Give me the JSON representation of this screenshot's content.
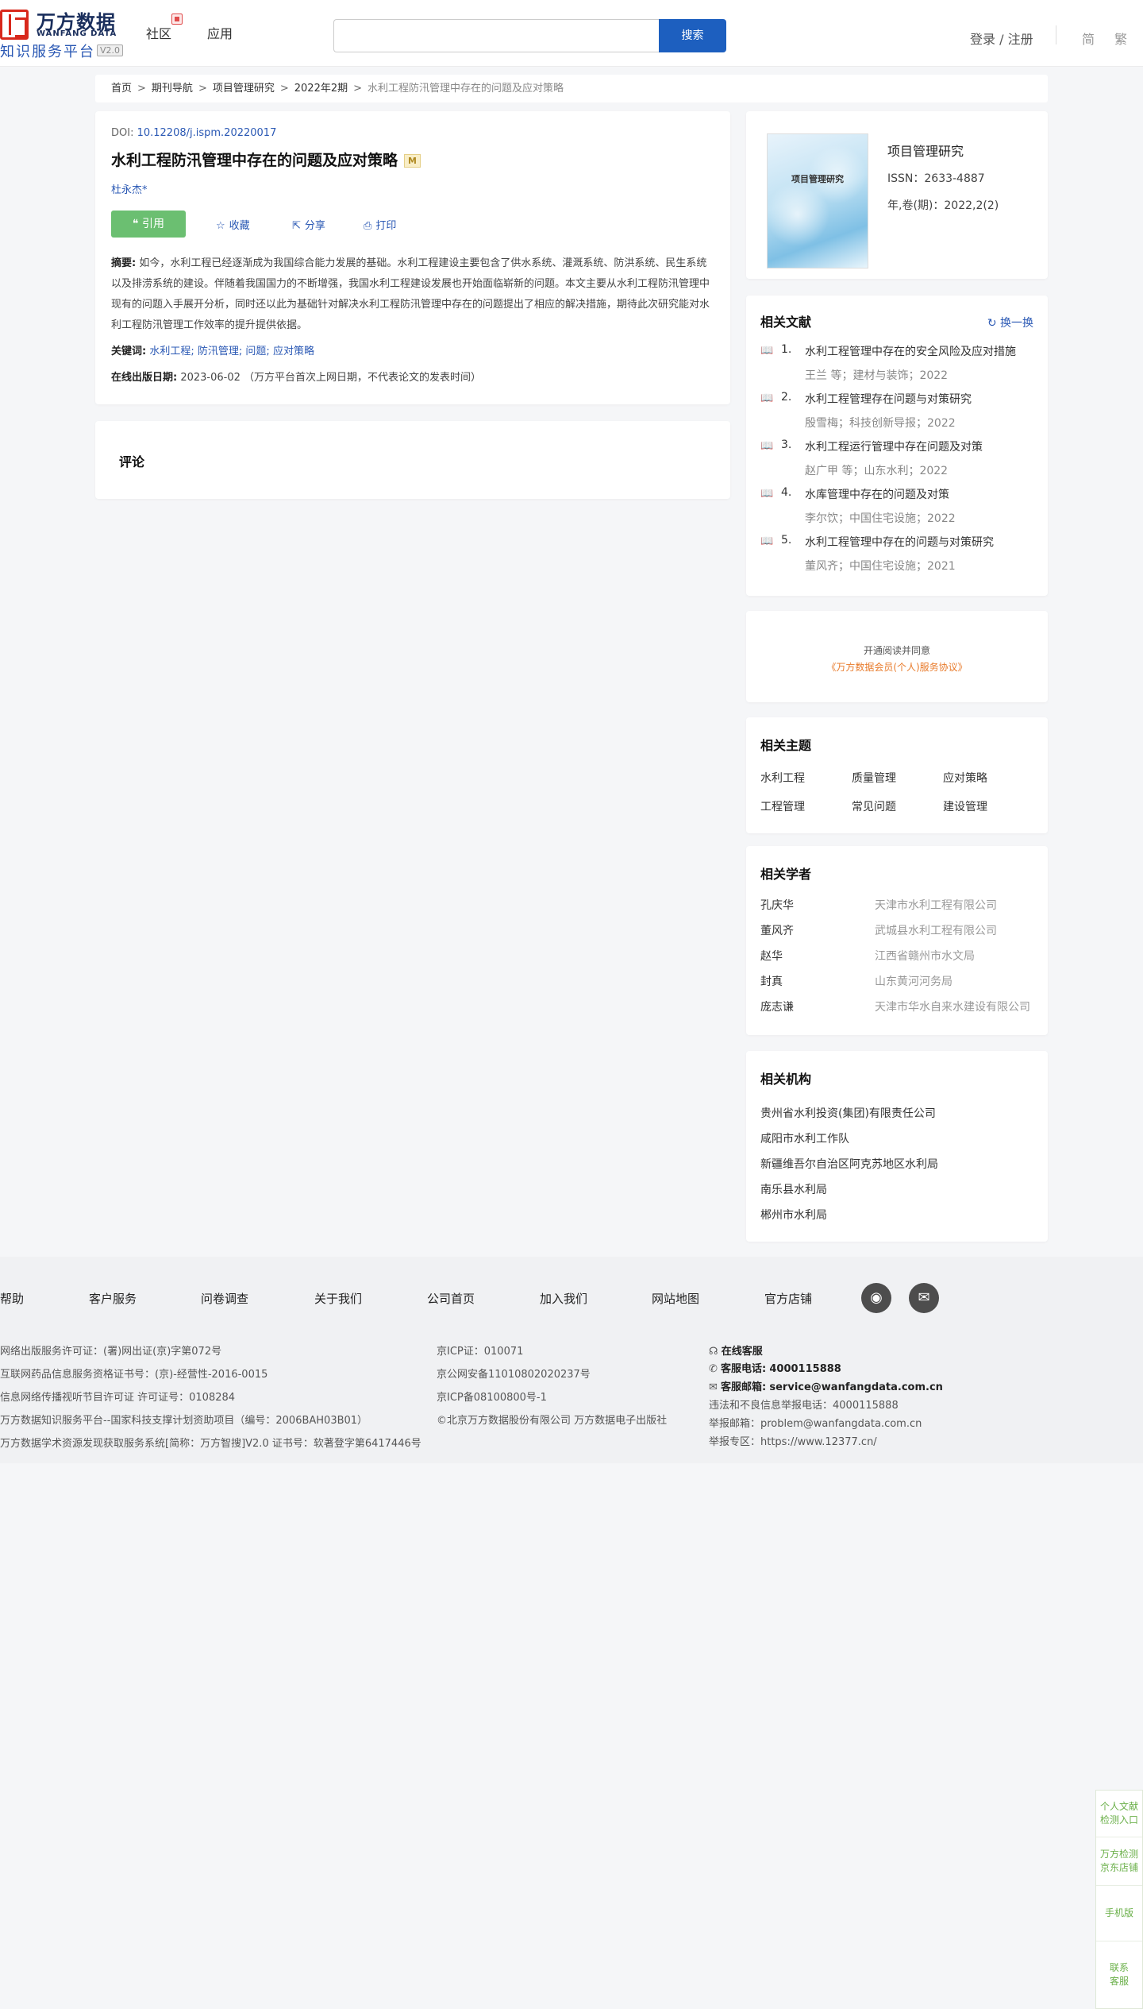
{
  "header": {
    "logo_cn": "万方数据",
    "logo_en": "WANFANG DATA",
    "logo_sub": "知识服务平台",
    "logo_version": "V2.0",
    "nav_community": "社区",
    "nav_app": "应用",
    "search_placeholder": "",
    "search_button": "搜索",
    "login": "登录 / 注册",
    "lang_simplified": "简",
    "lang_traditional": "繁"
  },
  "breadcrumb": {
    "items": [
      "首页",
      "期刊导航",
      "项目管理研究",
      "2022年2期"
    ],
    "current": "水利工程防汛管理中存在的问题及应对策略"
  },
  "article": {
    "doi_label": "DOI: ",
    "doi": "10.12208/j.ispm.20220017",
    "title": "水利工程防汛管理中存在的问题及应对策略",
    "badge": "M",
    "author": "杜永杰*",
    "cite_label": "引用",
    "collect_label": "收藏",
    "share_label": "分享",
    "print_label": "打印",
    "abstract_label": "摘要:",
    "abstract": "如今，水利工程已经逐渐成为我国综合能力发展的基础。水利工程建设主要包含了供水系统、灌溉系统、防洪系统、民生系统以及排涝系统的建设。伴随着我国国力的不断增强，我国水利工程建设发展也开始面临崭新的问题。本文主要从水利工程防汛管理中现有的问题入手展开分析，同时还以此为基础针对解决水利工程防汛管理中存在的问题提出了相应的解决措施，期待此次研究能对水利工程防汛管理工作效率的提升提供依据。",
    "keywords_label": "关键词:",
    "keywords": [
      "水利工程",
      "防汛管理",
      "问题",
      "应对策略"
    ],
    "date_label": "在线出版日期:",
    "date": "2023-06-02",
    "date_note": "（万方平台首次上网日期，不代表论文的发表时间）"
  },
  "comment": {
    "title": "评论"
  },
  "journal": {
    "cover_title": "项目管理研究",
    "name": "项目管理研究",
    "issn": "ISSN：2633-4887",
    "volume": "年,卷(期)：2022,2(2)"
  },
  "related_docs": {
    "title": "相关文献",
    "refresh_label": "换一换",
    "items": [
      {
        "num": "1.",
        "title": "水利工程管理中存在的安全风险及应对措施",
        "meta": "王兰  等；建材与装饰；2022"
      },
      {
        "num": "2.",
        "title": "水利工程管理存在问题与对策研究",
        "meta": "殷雪梅；科技创新导报；2022"
      },
      {
        "num": "3.",
        "title": "水利工程运行管理中存在问题及对策",
        "meta": "赵广甲  等；山东水利；2022"
      },
      {
        "num": "4.",
        "title": "水库管理中存在的问题及对策",
        "meta": "李尔饮；中国住宅设施；2022"
      },
      {
        "num": "5.",
        "title": "水利工程管理中存在的问题与对策研究",
        "meta": "董风齐；中国住宅设施；2021"
      }
    ]
  },
  "agreement": {
    "line1": "开通阅读并同意",
    "line2": "《万方数据会员(个人)服务协议》"
  },
  "topics": {
    "title": "相关主题",
    "items": [
      "水利工程",
      "质量管理",
      "应对策略",
      "工程管理",
      "常见问题",
      "建设管理"
    ]
  },
  "scholars": {
    "title": "相关学者",
    "items": [
      {
        "name": "孔庆华",
        "org": "天津市水利工程有限公司"
      },
      {
        "name": "董风齐",
        "org": "武城县水利工程有限公司"
      },
      {
        "name": "赵华",
        "org": "江西省赣州市水文局"
      },
      {
        "name": "封真",
        "org": "山东黄河河务局"
      },
      {
        "name": "庞志谦",
        "org": "天津市华水自来水建设有限公司"
      }
    ]
  },
  "orgs": {
    "title": "相关机构",
    "items": [
      "贵州省水利投资(集团)有限责任公司",
      "咸阳市水利工作队",
      "新疆维吾尔自治区阿克苏地区水利局",
      "南乐县水利局",
      "郴州市水利局"
    ]
  },
  "footer": {
    "nav": [
      "帮助",
      "客户服务",
      "问卷调查",
      "关于我们",
      "公司首页",
      "加入我们",
      "网站地图",
      "官方店铺"
    ],
    "col1": [
      "网络出版服务许可证：(署)网出证(京)字第072号",
      "互联网药品信息服务资格证书号：(京)-经营性-2016-0015",
      "信息网络传播视听节目许可证 许可证号：0108284",
      "万方数据知识服务平台--国家科技支撑计划资助项目（编号：2006BAH03B01）",
      "万方数据学术资源发现获取服务系统[简称：万方智搜]V2.0 证书号：软著登字第6417446号"
    ],
    "col2": [
      "京ICP证：010071",
      "京公网安备11010802020237号",
      "京ICP备08100800号-1",
      "©北京万方数据股份有限公司 万方数据电子出版社"
    ],
    "online_service": "在线客服",
    "phone_label": "客服电话:",
    "phone": "4000115888",
    "email_label": "客服邮箱:",
    "email": "service@wanfangdata.com.cn",
    "report_phone": "违法和不良信息举报电话：4000115888",
    "report_email": "举报邮箱：problem@wanfangdata.com.cn",
    "report_site": "举报专区：https://www.12377.cn/"
  },
  "sidebar": {
    "items": [
      "个人文献检测入口",
      "万方检测京东店铺",
      "手机版",
      "联系客服"
    ]
  },
  "colors": {
    "brand_blue": "#1d5fbf",
    "link_blue": "#2a58b4",
    "cite_green": "#6bbf71",
    "logo_red": "#d8281c",
    "agreement_orange": "#e87a2a"
  }
}
